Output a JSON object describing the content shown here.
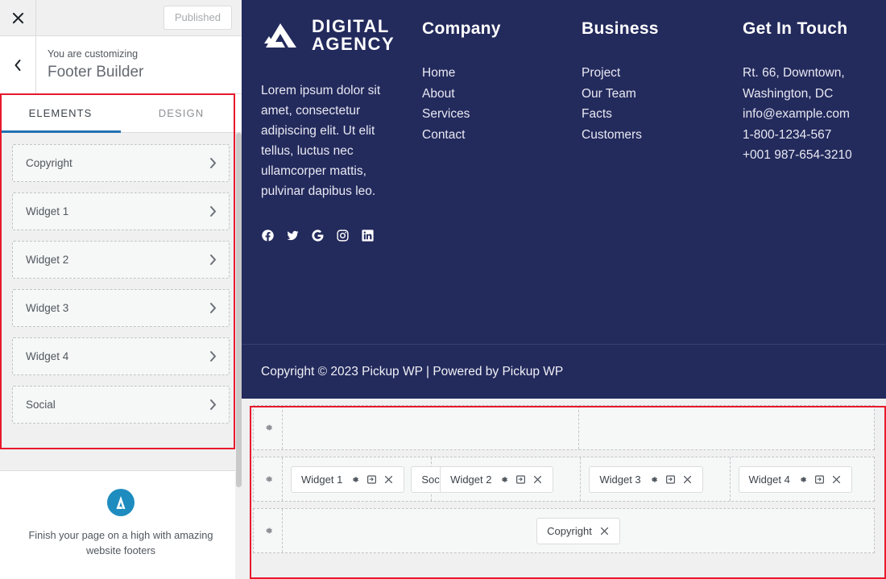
{
  "customizer": {
    "topbar": {
      "close_icon": "close-icon",
      "publish_label": "Published"
    },
    "header": {
      "back_icon": "chevron-left-icon",
      "eyebrow": "You are customizing",
      "title": "Footer Builder"
    },
    "tabs": [
      {
        "label": "ELEMENTS",
        "active": true
      },
      {
        "label": "DESIGN",
        "active": false
      }
    ],
    "elements": [
      {
        "label": "Copyright",
        "chevron": "chevron-right-icon"
      },
      {
        "label": "Widget 1",
        "chevron": "chevron-right-icon"
      },
      {
        "label": "Widget 2",
        "chevron": "chevron-right-icon"
      },
      {
        "label": "Widget 3",
        "chevron": "chevron-right-icon"
      },
      {
        "label": "Widget 4",
        "chevron": "chevron-right-icon"
      },
      {
        "label": "Social",
        "chevron": "chevron-right-icon"
      }
    ],
    "promo": {
      "logo_icon": "pickup-wp-logo-icon",
      "text": "Finish your page on a high with amazing website footers"
    }
  },
  "preview": {
    "footer": {
      "background_color": "#232a5c",
      "brand": {
        "mark_icon": "mountain-logo-icon",
        "name_line1": "DIGITAL",
        "name_line2": "AGENCY"
      },
      "description": "Lorem ipsum dolor sit amet, consectetur adipiscing elit. Ut elit tellus, luctus nec ullamcorper mattis, pulvinar dapibus leo.",
      "socials": [
        {
          "name": "facebook-icon"
        },
        {
          "name": "twitter-icon"
        },
        {
          "name": "google-icon"
        },
        {
          "name": "instagram-icon"
        },
        {
          "name": "linkedin-icon"
        }
      ],
      "columns": [
        {
          "heading": "Company",
          "links": [
            "Home",
            "About",
            "Services",
            "Contact"
          ]
        },
        {
          "heading": "Business",
          "links": [
            "Project",
            "Our Team",
            "Facts",
            "Customers"
          ]
        }
      ],
      "contact": {
        "heading": "Get In Touch",
        "lines": [
          "Rt. 66, Downtown,",
          "Washington, DC",
          "info@example.com",
          "1-800-1234-567",
          "+001 987-654-3210"
        ]
      },
      "bottom_bar": {
        "text": "Copyright © 2023 Pickup WP | Powered by Pickup WP"
      }
    }
  },
  "builder": {
    "highlight_color": "#e8192c",
    "rows": [
      {
        "name": "top-row",
        "gear_icon": "gear-icon",
        "columns": [
          {
            "align": "left",
            "chips": []
          },
          {
            "align": "left",
            "chips": []
          }
        ]
      },
      {
        "name": "middle-row",
        "gear_icon": "gear-icon",
        "columns": [
          {
            "align": "left",
            "chips": [
              {
                "label": "Widget 1",
                "icons": [
                  "gear-icon",
                  "swap-icon",
                  "close-icon"
                ]
              },
              {
                "label": "Social",
                "icons": [
                  "close-icon"
                ]
              }
            ]
          },
          {
            "align": "left",
            "chips": [
              {
                "label": "Widget 2",
                "icons": [
                  "gear-icon",
                  "swap-icon",
                  "close-icon"
                ]
              }
            ]
          },
          {
            "align": "left",
            "chips": [
              {
                "label": "Widget 3",
                "icons": [
                  "gear-icon",
                  "swap-icon",
                  "close-icon"
                ]
              }
            ]
          },
          {
            "align": "left",
            "chips": [
              {
                "label": "Widget 4",
                "icons": [
                  "gear-icon",
                  "swap-icon",
                  "close-icon"
                ]
              }
            ]
          }
        ]
      },
      {
        "name": "bottom-row",
        "gear_icon": "gear-icon",
        "columns": [
          {
            "align": "center",
            "chips": [
              {
                "label": "Copyright",
                "icons": [
                  "close-icon"
                ]
              }
            ]
          }
        ]
      }
    ]
  }
}
